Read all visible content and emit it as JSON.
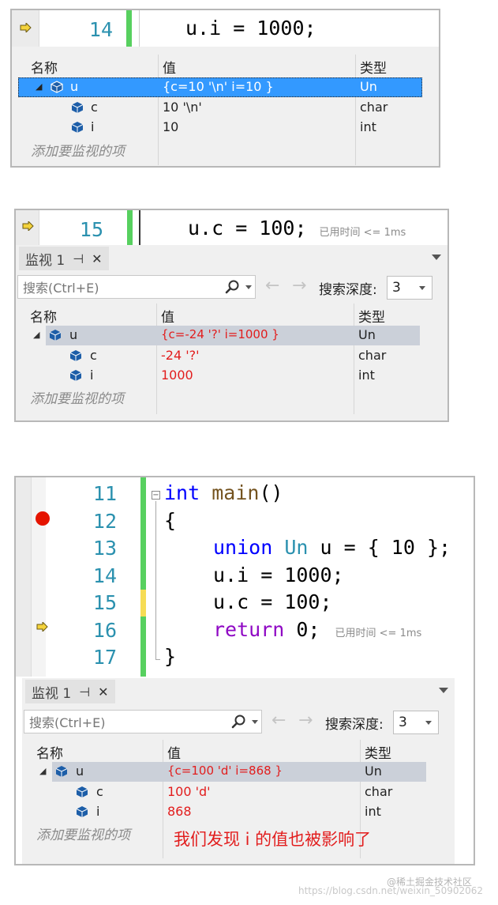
{
  "colors": {
    "accent_selected": "#3399ff",
    "changed_value": "#e21d1d",
    "line_number": "#2b91af",
    "keyword": "#0000ff",
    "ctrl_keyword": "#8f08c4",
    "breakpoint": "#e51400",
    "saved_bar": "#57d05f",
    "unsaved_bar": "#f6dc55"
  },
  "shared": {
    "watch_title": "监视 1",
    "search_placeholder": "搜索(Ctrl+E)",
    "depth_label": "搜索深度:",
    "depth_value": "3",
    "col_name": "名称",
    "col_value": "值",
    "col_type": "类型",
    "add_watch": "添加要监视的项",
    "elapsed": "已用时间 <= 1ms",
    "pin_glyph": "⊣",
    "close_glyph": "✕",
    "back_glyph": "←",
    "forward_glyph": "→"
  },
  "panel1": {
    "code_line": {
      "number": "14",
      "text": "u.i = 1000;"
    },
    "rows": [
      {
        "name": "u",
        "value": "{c=10 '\\n' i=10 }",
        "type": "Un"
      },
      {
        "name": "c",
        "value": "10 '\\n'",
        "type": "char"
      },
      {
        "name": "i",
        "value": "10",
        "type": "int"
      }
    ]
  },
  "panel2": {
    "code_line": {
      "number": "15",
      "text": "u.c = 100;"
    },
    "rows": [
      {
        "name": "u",
        "value": "{c=-24 '?' i=1000 }",
        "type": "Un"
      },
      {
        "name": "c",
        "value": "-24 '?'",
        "type": "char"
      },
      {
        "name": "i",
        "value": "1000",
        "type": "int"
      }
    ]
  },
  "panel3": {
    "code_lines": [
      {
        "number": "11"
      },
      {
        "number": "12"
      },
      {
        "number": "13"
      },
      {
        "number": "14"
      },
      {
        "number": "15"
      },
      {
        "number": "16"
      },
      {
        "number": "17"
      }
    ],
    "code": {
      "l11_kw": "int",
      "l11_fn": "main",
      "l11_rest": "()",
      "l12": "{",
      "l13_kw": "union",
      "l13_ty": "Un",
      "l13_rest": " u = { 10 };",
      "l14": "u.i = 1000;",
      "l15": "u.c = 100;",
      "l16_kw": "return",
      "l16_rest": " 0;",
      "l17": "}"
    },
    "rows": [
      {
        "name": "u",
        "value": "{c=100 'd' i=868 }",
        "type": "Un"
      },
      {
        "name": "c",
        "value": "100 'd'",
        "type": "char"
      },
      {
        "name": "i",
        "value": "868",
        "type": "int"
      }
    ],
    "annotation": "我们发现 i 的值也被影响了"
  },
  "watermark": {
    "text": "https://blog.csdn.net/weixin_50902062",
    "logo": "@稀土掘金技术社区"
  }
}
